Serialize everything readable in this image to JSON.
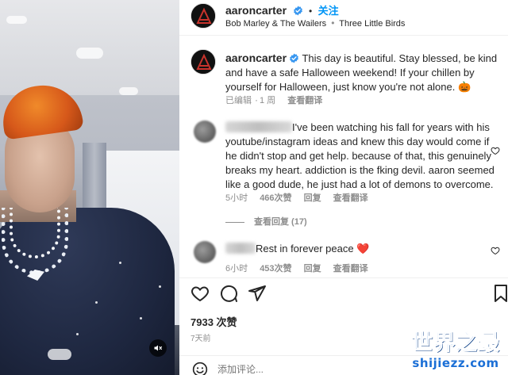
{
  "header": {
    "username": "aaroncarter",
    "follow_label": "关注",
    "audio": "Bob Marley & The Wailers",
    "audio_track": "Three Little Birds"
  },
  "caption": {
    "username": "aaroncarter",
    "text": "This day is beautiful. Stay blessed, be kind and have a safe Halloween weekend! If your chillen by yourself for Halloween, just know you're not alone.",
    "emoji": "🎃",
    "edited": "已编辑",
    "time": "1 周",
    "translate": "查看翻译"
  },
  "comments": [
    {
      "text": "I've been watching his fall for years with his youtube/instagram ideas and knew this day would come if he didn't stop and get help. because of that, this genuinely breaks my heart. addiction is the fking devil. aaron seemed like a good dude, he just had a lot of demons to overcome.",
      "time": "5小时",
      "likes": "466次赞",
      "reply": "回复",
      "translate": "查看翻译",
      "replies": "查看回复 (17)"
    },
    {
      "text": "Rest in forever peace",
      "emoji": "❤️",
      "time": "6小时",
      "likes": "453次赞",
      "reply": "回复",
      "translate": "查看翻译"
    }
  ],
  "post": {
    "likes": "7933 次赞",
    "age": "7天前",
    "comment_placeholder": "添加评论..."
  },
  "watermark": {
    "title": "世界之最",
    "domain": "shijiezz.com"
  },
  "icons": {
    "like": "heart-icon",
    "comment": "comment-icon",
    "share": "paper-plane-icon",
    "save": "bookmark-icon",
    "mute": "speaker-muted-icon",
    "emoji": "smiley-icon"
  },
  "colors": {
    "follow_blue": "#0095f6",
    "verified_blue": "#3897f0",
    "heart_red": "#ed4956"
  }
}
